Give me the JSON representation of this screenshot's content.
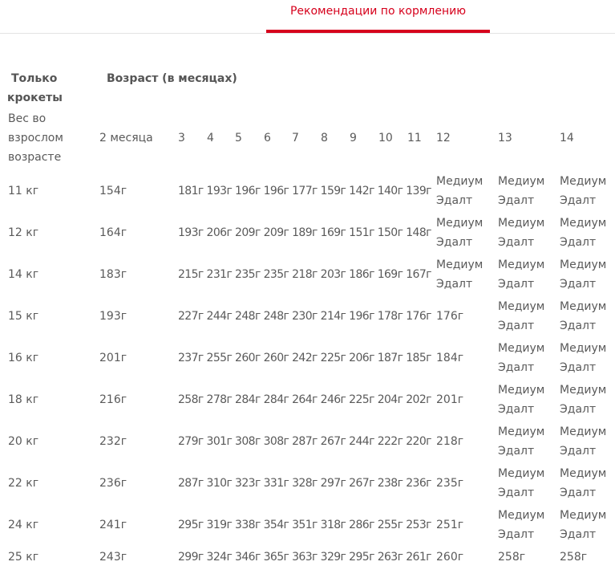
{
  "tab": {
    "label": "Рекомендации по кормлению"
  },
  "header": {
    "only_line1": "Только",
    "only_line2": "крокеты",
    "age_title": "Возраст (в месяцах)",
    "weight_line1": "Вес во",
    "weight_line2": "взрослом",
    "weight_line3": "возрасте"
  },
  "months": [
    "2 месяца",
    "3",
    "4",
    "5",
    "6",
    "7",
    "8",
    "9",
    "10",
    "11",
    "12",
    "13",
    "14"
  ],
  "medium_adult": [
    "Медиум",
    "Эдалт"
  ],
  "rows": [
    {
      "weight": "11 кг",
      "m2": "154г",
      "vals": "181г 193г 196г 196г 177г 159г 142г 140г 139г",
      "m12": "",
      "m13": "",
      "m14": ""
    },
    {
      "weight": "12 кг",
      "m2": "164г",
      "vals": "193г 206г 209г 209г 189г 169г 151г 150г 148г",
      "m12": "",
      "m13": "",
      "m14": ""
    },
    {
      "weight": "14 кг",
      "m2": "183г",
      "vals": "215г 231г 235г 235г 218г 203г 186г 169г 167г",
      "m12": "",
      "m13": "",
      "m14": ""
    },
    {
      "weight": "15 кг",
      "m2": "193г",
      "vals": "227г 244г 248г 248г 230г 214г 196г 178г 176г",
      "m12": "176г",
      "m13": "",
      "m14": ""
    },
    {
      "weight": "16 кг",
      "m2": "201г",
      "vals": "237г 255г 260г 260г 242г 225г 206г 187г 185г",
      "m12": "184г",
      "m13": "",
      "m14": ""
    },
    {
      "weight": "18 кг",
      "m2": "216г",
      "vals": "258г 278г 284г 284г 264г 246г 225г 204г 202г",
      "m12": "201г",
      "m13": "",
      "m14": ""
    },
    {
      "weight": "20 кг",
      "m2": "232г",
      "vals": "279г 301г 308г 308г 287г 267г 244г 222г 220г",
      "m12": "218г",
      "m13": "",
      "m14": ""
    },
    {
      "weight": "22 кг",
      "m2": "236г",
      "vals": "287г 310г 323г 331г 328г 297г 267г 238г 236г",
      "m12": "235г",
      "m13": "",
      "m14": ""
    },
    {
      "weight": "24 кг",
      "m2": "241г",
      "vals": "295г 319г 338г 354г 351г 318г 286г 255г 253г",
      "m12": "251г",
      "m13": "",
      "m14": ""
    },
    {
      "weight": "25 кг",
      "m2": "243г",
      "vals": "299г 324г 346г 365г 363г 329г 295г 263г 261г",
      "m12": "260г",
      "m13": "258г",
      "m14": "258г"
    }
  ]
}
